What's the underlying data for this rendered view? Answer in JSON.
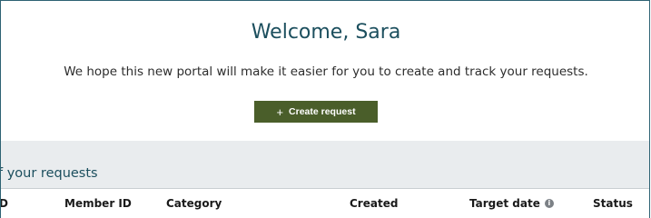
{
  "welcome": {
    "title": "Welcome, Sara",
    "subtitle": "We hope this new portal will make it easier for you to create and track your requests."
  },
  "create_button": {
    "icon": "plus-icon",
    "label": "Create request",
    "color": "#4a5e2a"
  },
  "requests": {
    "section_title": "f your requests",
    "columns": [
      {
        "label": "D"
      },
      {
        "label": "Member ID"
      },
      {
        "label": "Category"
      },
      {
        "label": "Created"
      },
      {
        "label": "Target date",
        "icon": "info-icon"
      },
      {
        "label": "Status"
      }
    ]
  }
}
